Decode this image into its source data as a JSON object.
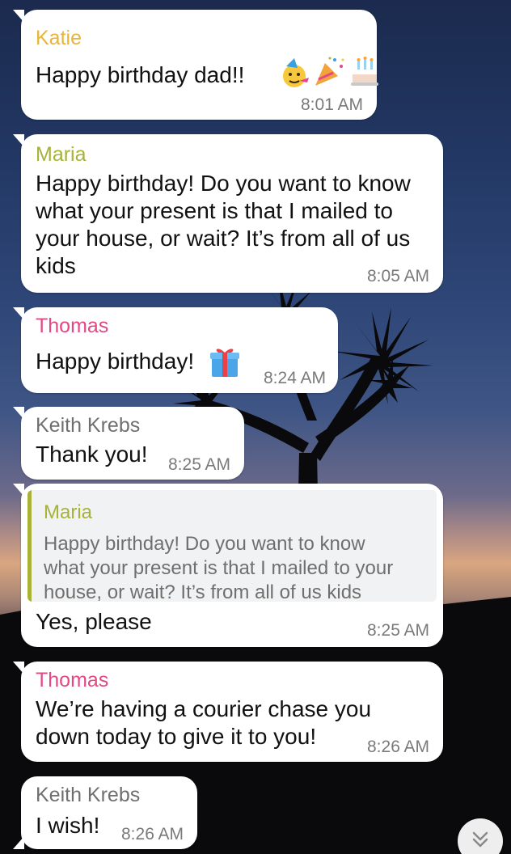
{
  "colors": {
    "katie": "#e8b43a",
    "maria": "#a7b236",
    "thomas": "#e54885",
    "keith": "#6f6f6f",
    "bubble": "#ffffff",
    "timestamp": "#7a7a7a"
  },
  "messages": [
    {
      "sender": "Katie",
      "text": "Happy birthday dad!!",
      "emojis": [
        "party-face-icon",
        "party-popper-icon",
        "birthday-cake-icon"
      ],
      "time": "8:01 AM"
    },
    {
      "sender": "Maria",
      "lines": [
        "Happy birthday! Do you want to know",
        "what your present is that I mailed to",
        "your house, or wait? It’s from all of us",
        "kids"
      ],
      "time": "8:05 AM"
    },
    {
      "sender": "Thomas",
      "text": "Happy birthday!",
      "emojis": [
        "gift-icon"
      ],
      "time": "8:24 AM"
    },
    {
      "sender": "Keith Krebs",
      "text": "Thank you!",
      "time": "8:25 AM"
    },
    {
      "reply_to": {
        "sender": "Maria",
        "lines": [
          "Happy birthday! Do you want to know",
          "what your present is that I mailed to your",
          "house, or wait? It’s from all of us kids"
        ]
      },
      "text": "Yes, please",
      "time": "8:25 AM"
    },
    {
      "sender": "Thomas",
      "lines": [
        "We’re having a courier chase you",
        "down today to give it to you!"
      ],
      "time": "8:26 AM"
    },
    {
      "sender": "Keith Krebs",
      "text": "I wish!",
      "time": "8:26 AM"
    }
  ],
  "scroll_button": {
    "icon": "chevron-double-down-icon"
  }
}
